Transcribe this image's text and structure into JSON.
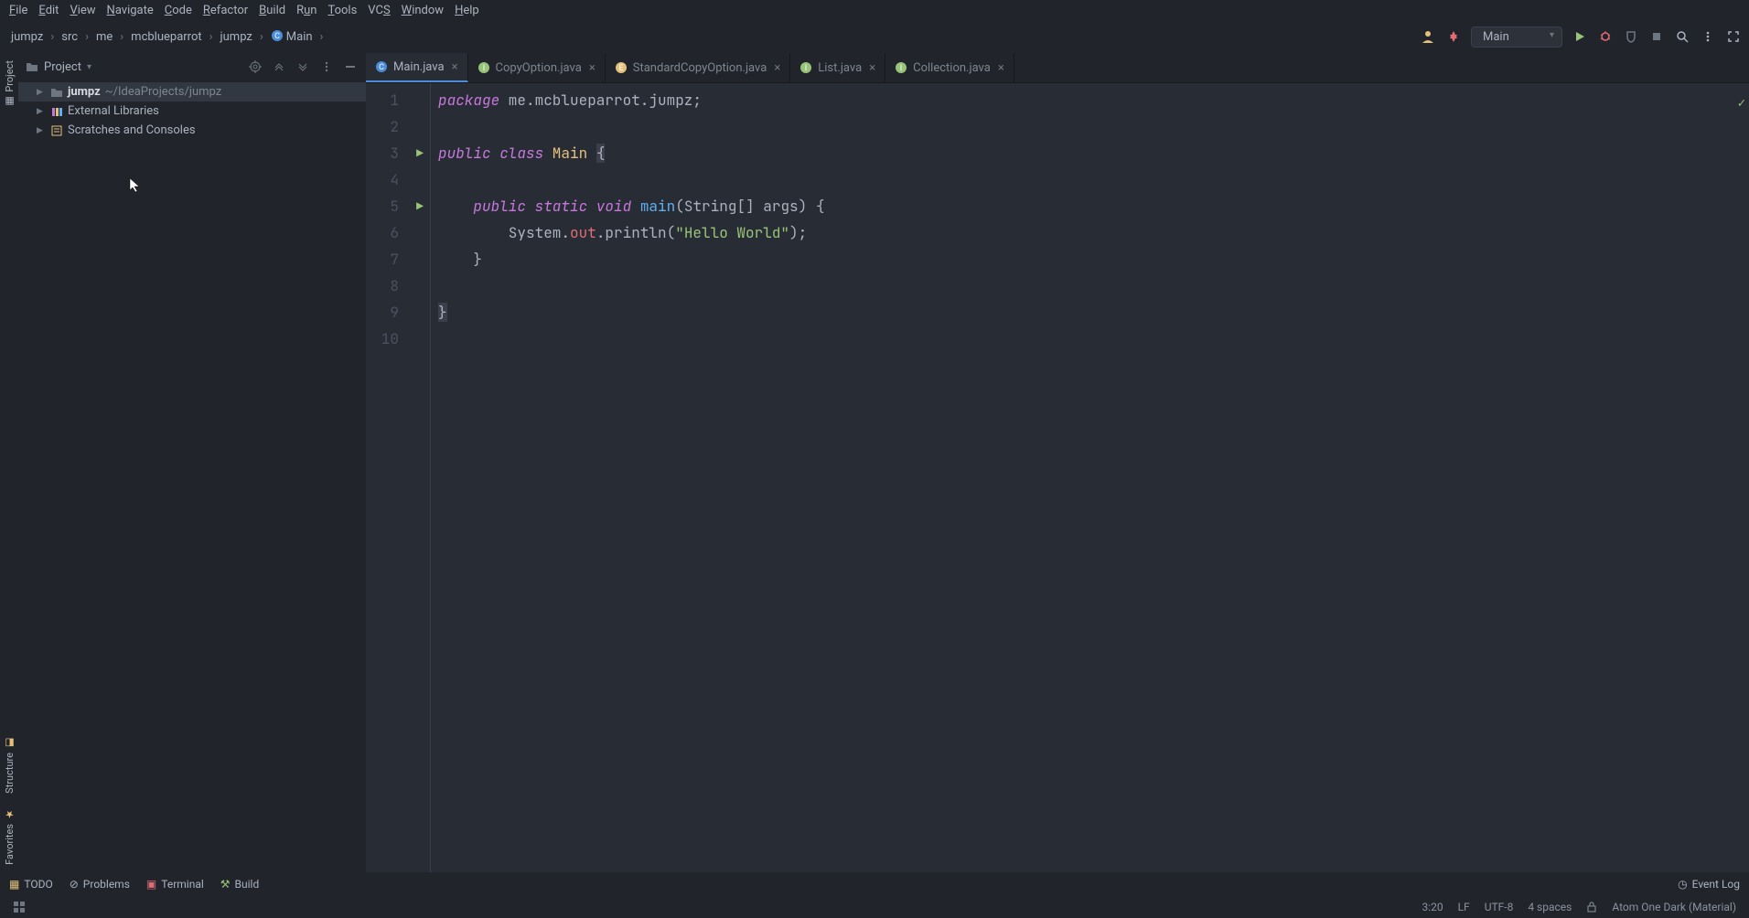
{
  "menu": [
    "File",
    "Edit",
    "View",
    "Navigate",
    "Code",
    "Refactor",
    "Build",
    "Run",
    "Tools",
    "VCS",
    "Window",
    "Help"
  ],
  "breadcrumbs": [
    "jumpz",
    "src",
    "me",
    "mcblueparrot",
    "jumpz",
    "Main"
  ],
  "run_config": "Main",
  "sidebar": {
    "title": "Project",
    "tree": [
      {
        "name": "jumpz",
        "path": "~/IdeaProjects/jumpz",
        "icon": "folder",
        "selected": true
      },
      {
        "name": "External Libraries",
        "icon": "lib"
      },
      {
        "name": "Scratches and Consoles",
        "icon": "scratch"
      }
    ]
  },
  "tabs": [
    {
      "label": "Main.java",
      "icon": "class",
      "active": true
    },
    {
      "label": "CopyOption.java",
      "icon": "interface"
    },
    {
      "label": "StandardCopyOption.java",
      "icon": "annotation"
    },
    {
      "label": "List.java",
      "icon": "interface"
    },
    {
      "label": "Collection.java",
      "icon": "interface"
    }
  ],
  "code": {
    "line1_kw": "package",
    "line1_rest": " me.mcblueparrot.jumpz;",
    "line3_kw": "public class",
    "line3_cls": " Main ",
    "line3_brace": "{",
    "line5_kw": "public static void",
    "line5_fn": " main",
    "line5_sig1": "(",
    "line5_sig2": "String",
    "line5_sig3": "[] args) {",
    "line6_pre": "        System.",
    "line6_out": "out",
    "line6_mid": ".println(",
    "line6_str": "\"Hello World\"",
    "line6_end": ");",
    "line7": "    }",
    "line9": "}"
  },
  "bottom": {
    "todo": "TODO",
    "problems": "Problems",
    "terminal": "Terminal",
    "build": "Build",
    "eventlog": "Event Log"
  },
  "status": {
    "cursor": "3:20",
    "line_ending": "LF",
    "encoding": "UTF-8",
    "indent": "4 spaces",
    "theme": "Atom One Dark (Material)"
  },
  "rails": {
    "project": "Project",
    "structure": "Structure",
    "favorites": "Favorites"
  }
}
